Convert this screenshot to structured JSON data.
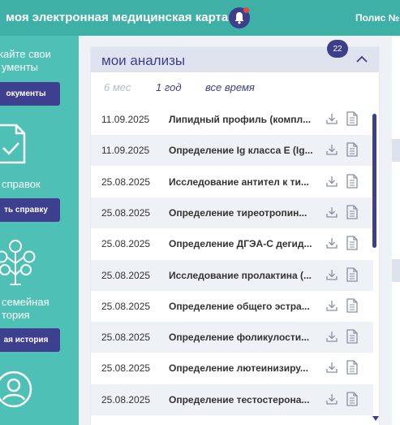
{
  "header": {
    "title": "моя электронная медицинская карта",
    "policy_label": "Полис № -"
  },
  "sidebar": {
    "documents_text_1": "кайте свои",
    "documents_text_2": "ументы",
    "documents_button": "окументы",
    "certificates_text": "справок",
    "certificates_button": "ть справку",
    "family_text_1": "семейная",
    "family_text_2": "тория",
    "family_button": "ая история"
  },
  "analyses": {
    "title": "мои анализы",
    "badge_count": "22",
    "filters": [
      "6 мес",
      "1 год",
      "все время"
    ],
    "rows": [
      {
        "date": "11.09.2025",
        "name": "Липидный профиль (компл..."
      },
      {
        "date": "11.09.2025",
        "name": "Определение Ig класса E (Ig..."
      },
      {
        "date": "25.08.2025",
        "name": "Исследование антител к ти..."
      },
      {
        "date": "25.08.2025",
        "name": "Определение тиреотропин..."
      },
      {
        "date": "25.08.2025",
        "name": "Определение ДГЭА-С дегид..."
      },
      {
        "date": "25.08.2025",
        "name": "Исследование пролактина (..."
      },
      {
        "date": "25.08.2025",
        "name": "Определение общего эстра..."
      },
      {
        "date": "25.08.2025",
        "name": "Определение фоликулости..."
      },
      {
        "date": "25.08.2025",
        "name": "Определение лютеинизиру..."
      },
      {
        "date": "25.08.2025",
        "name": "Определение тестостерона..."
      }
    ]
  },
  "colors": {
    "teal": "#3eb0a6",
    "sidebar": "#4fc0b6",
    "navy": "#3d3f8c",
    "filter_inactive": "#b8bcc8",
    "row_alt": "#eef1f6"
  }
}
